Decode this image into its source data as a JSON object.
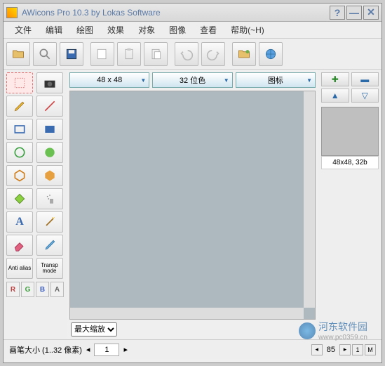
{
  "titlebar": {
    "title": "AWicons Pro 10.3 by Lokas Software"
  },
  "menubar": {
    "items": [
      "文件",
      "编辑",
      "绘图",
      "效果",
      "对象",
      "图像",
      "查看",
      "帮助(~H)"
    ]
  },
  "dropdowns": {
    "size": "48 x 48",
    "color": "32 位色",
    "type": "图标"
  },
  "toolbox": {
    "anti": "Anti alias",
    "transp": "Transp mode",
    "rgba": [
      "R",
      "G",
      "B",
      "A"
    ]
  },
  "zoom": {
    "label": "最大缩放"
  },
  "brush": {
    "label": "画笔大小 (1..32 像素)",
    "value": "1"
  },
  "preview": {
    "label": "48x48, 32b"
  },
  "right_status": {
    "num": "85",
    "letters": [
      "1",
      "M"
    ]
  },
  "watermark": {
    "text": "河东软件园",
    "url": "www.pc0359.cn"
  }
}
